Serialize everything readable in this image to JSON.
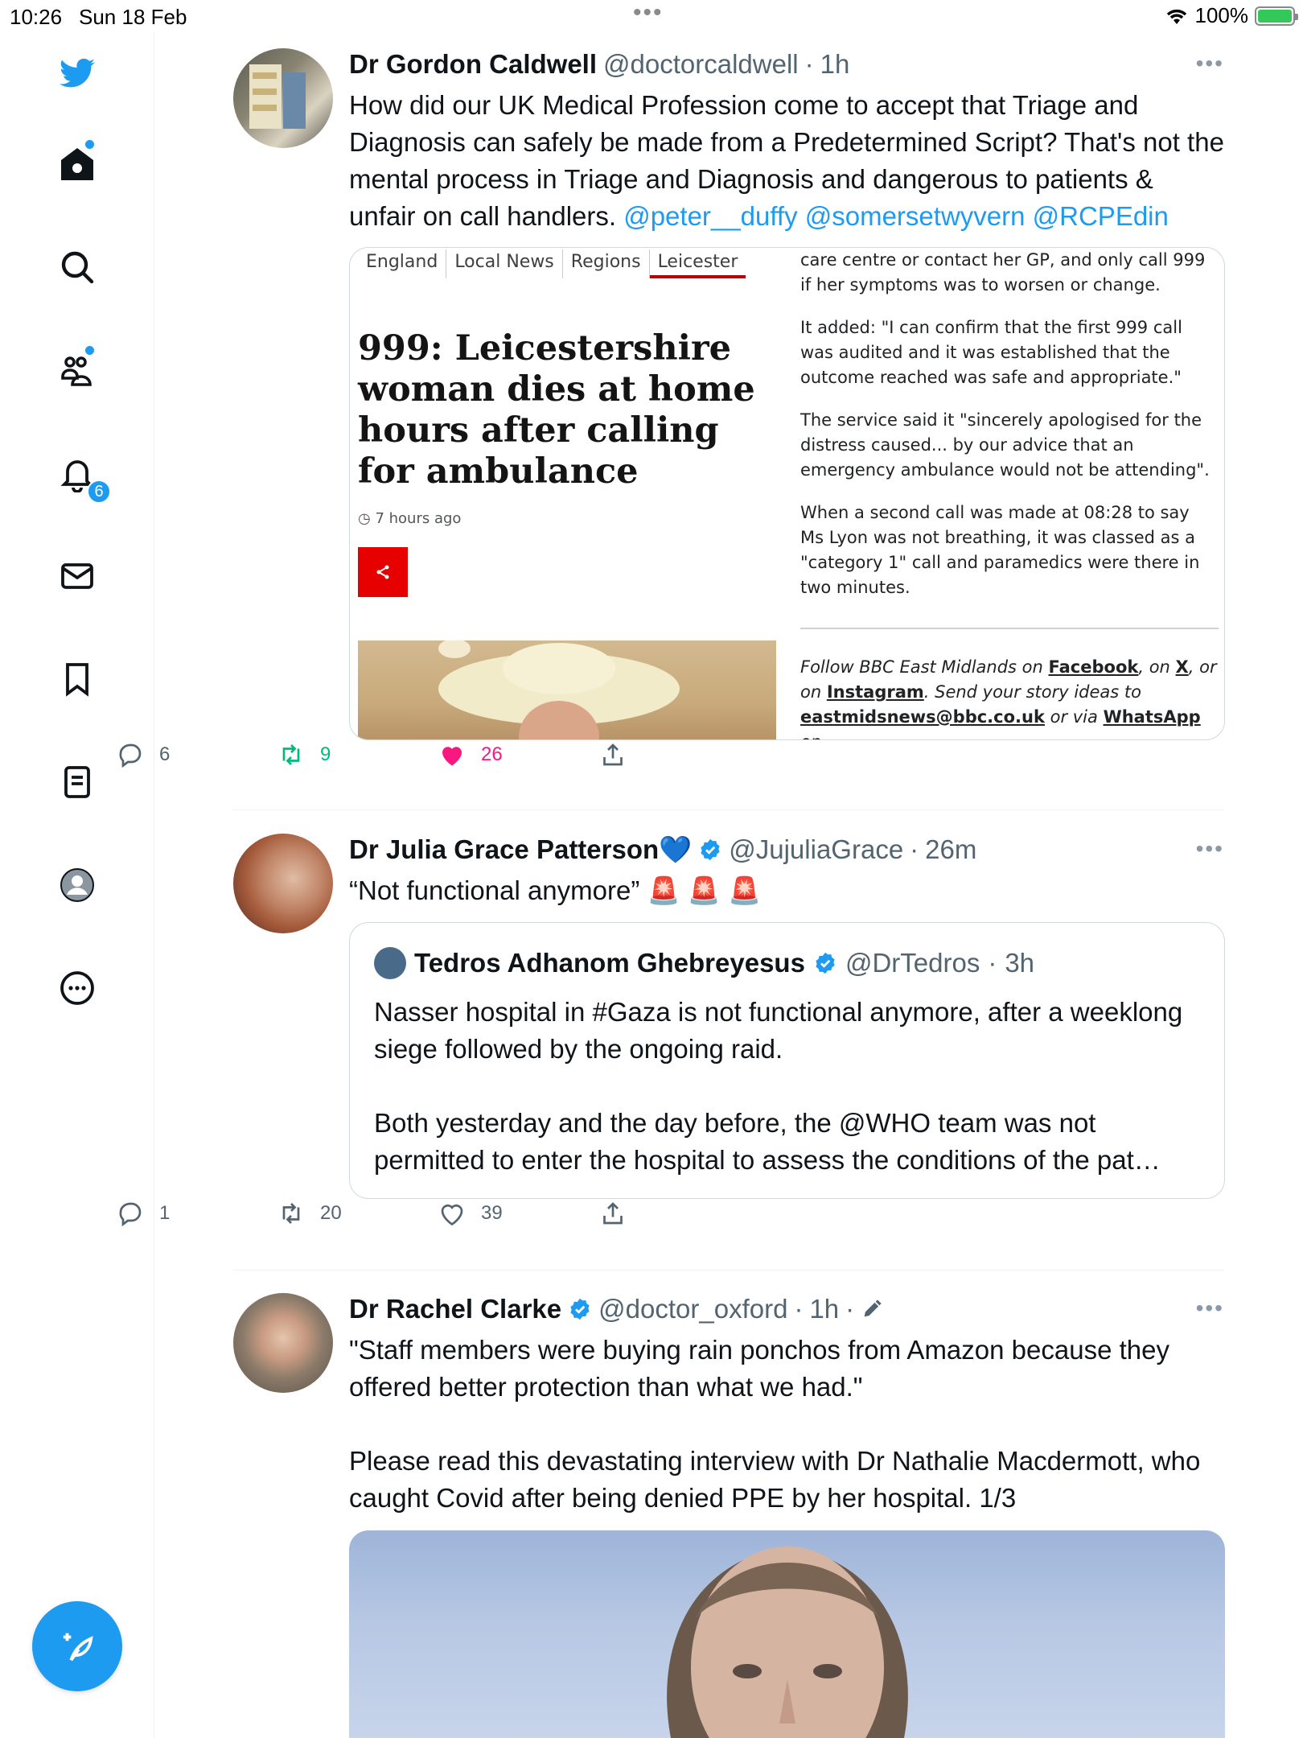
{
  "status_bar": {
    "time": "10:26",
    "date": "Sun 18 Feb",
    "battery": "100%"
  },
  "sidebar": {
    "notification_count": "6",
    "items": [
      {
        "icon": "twitter-bird-icon"
      },
      {
        "icon": "home-icon"
      },
      {
        "icon": "search-icon"
      },
      {
        "icon": "communities-icon"
      },
      {
        "icon": "notifications-bell-icon"
      },
      {
        "icon": "messages-envelope-icon"
      },
      {
        "icon": "bookmark-icon"
      },
      {
        "icon": "lists-icon"
      },
      {
        "icon": "profile-avatar-icon"
      },
      {
        "icon": "more-circle-icon"
      }
    ],
    "compose_icon": "compose-feather-icon",
    "accent_color": "#1d9bf0"
  },
  "tweets": [
    {
      "name": "Dr Gordon Caldwell",
      "handle": "@doctorcaldwell",
      "time": "1h",
      "text": "How did our UK Medical Profession come to accept that Triage and Diagnosis can safely be made from a Predetermined Script? That's not the mental process in Triage and Diagnosis and dangerous to patients & unfair on call handlers.",
      "mentions": "@peter__duffy @somersetwyvern @RCPEdin",
      "media": {
        "nav": [
          "England",
          "Local News",
          "Regions",
          "Leicester"
        ],
        "headline": "999: Leicestershire woman dies at home hours after calling for ambulance",
        "time_ago": "7 hours ago",
        "paragraphs": [
          "care centre or contact her GP, and only call 999 if her symptoms was to worsen or change.",
          "It added: \"I can confirm that the first 999 call was audited and it was established that the outcome reached was safe and appropriate.\"",
          "The service said it \"sincerely apologised for the distress caused... by our advice that an emergency ambulance would not be attending\".",
          "When a second call was made at 08:28 to say Ms Lyon was not breathing, it was classed as a \"category 1\" call and paramedics were there in two minutes."
        ],
        "follow": {
          "p1": "Follow BBC East Midlands on ",
          "facebook": "Facebook",
          "p2": ", on ",
          "x": "X",
          "p3": ", or on ",
          "instagram": "Instagram",
          "p4": ". Send your story ideas to ",
          "email": "eastmidsnews@bbc.co.uk",
          "p5": " or via ",
          "whatsapp": "WhatsApp",
          "p6": " on"
        }
      },
      "replies": "6",
      "retweets": "9",
      "likes": "26",
      "liked": true
    },
    {
      "name": "Dr Julia Grace Patterson💙",
      "handle": "@JujuliaGrace",
      "time": "26m",
      "text": "“Not functional anymore” 🚨 🚨 🚨",
      "quote": {
        "name": "Tedros Adhanom Ghebreyesus",
        "handle": "@DrTedros",
        "time": "3h",
        "text1": "Nasser hospital in #Gaza is not functional anymore, after a weeklong siege followed by the ongoing raid.",
        "text2": "Both yesterday and the day before, the @WHO team was not permitted to enter the hospital to assess the conditions of the pat…"
      },
      "replies": "1",
      "retweets": "20",
      "likes": "39",
      "liked": false
    },
    {
      "name": "Dr Rachel Clarke",
      "handle": "@doctor_oxford",
      "time": "1h",
      "text1": "\"Staff members were buying rain ponchos from Amazon because they offered better protection than what we had.\"",
      "text2": "Please read this devastating interview with Dr Nathalie Macdermott, who caught Covid after being denied PPE by her hospital. 1/3"
    }
  ]
}
